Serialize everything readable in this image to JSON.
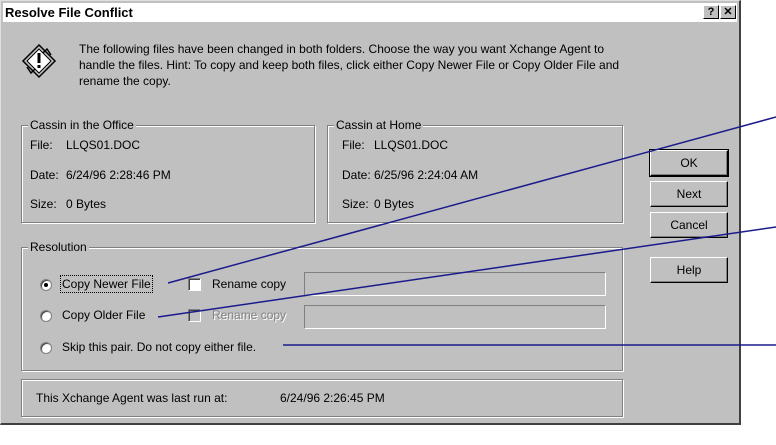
{
  "dialog": {
    "title": "Resolve File Conflict",
    "help_glyph": "?",
    "close_glyph": "✕",
    "intro": "The following files have been changed in both folders.  Choose the way you want Xchange Agent to handle the files.  Hint: To copy and keep both files, click either Copy Newer File or Copy Older File and rename the copy."
  },
  "office": {
    "label": "Cassin in the Office",
    "file_label": "File:",
    "file": "LLQS01.DOC",
    "date_label": "Date:",
    "date": "6/24/96 2:28:46 PM",
    "size_label": "Size:",
    "size": "0 Bytes"
  },
  "home": {
    "label": "Cassin at Home",
    "file_label": "File:",
    "file": "LLQS01.DOC",
    "date_label": "Date:",
    "date": "6/25/96 2:24:04 AM",
    "size_label": "Size:",
    "size": "0 Bytes"
  },
  "resolution": {
    "label": "Resolution",
    "options": [
      {
        "label": "Copy Newer File",
        "selected": true
      },
      {
        "label": "Copy Older File",
        "selected": false
      },
      {
        "label": "Skip this pair. Do not copy either file.",
        "selected": false
      }
    ],
    "rename_newer": "Rename copy",
    "rename_older": "Rename copy"
  },
  "status": {
    "label": "This Xchange Agent was last run at:",
    "value": "6/24/96 2:26:45 PM"
  },
  "buttons": {
    "ok": "OK",
    "next": "Next",
    "cancel": "Cancel",
    "help": "Help"
  },
  "colors": {
    "dialog_bg": "#c0c0c0",
    "callout_line": "#1a1a8c"
  }
}
